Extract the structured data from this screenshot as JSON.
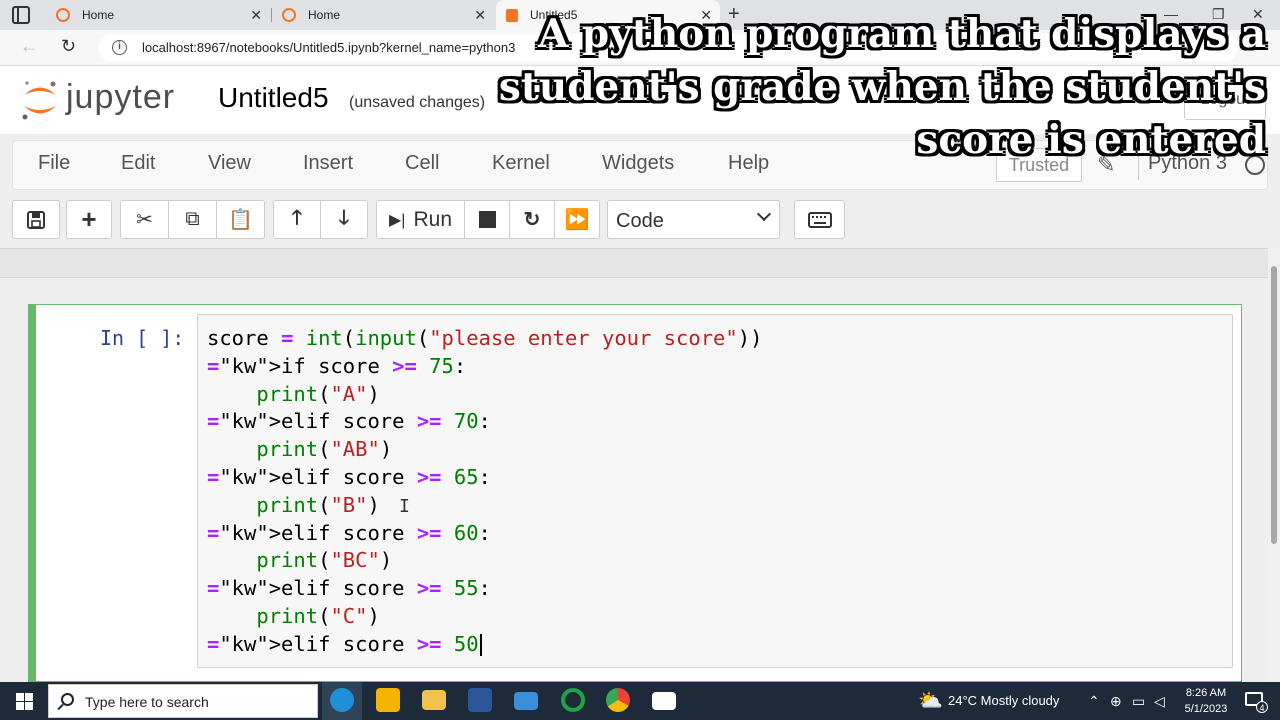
{
  "browser": {
    "tabs": [
      {
        "title": "Home"
      },
      {
        "title": "Home"
      },
      {
        "title": "Untitled5"
      }
    ],
    "url": "localhost:8967/notebooks/Untitled5.ipynb?kernel_name=python3"
  },
  "jupyter": {
    "logo_text": "jupyter",
    "notebook_title": "Untitled5",
    "save_status": "(unsaved changes)",
    "logout_label": "Logout",
    "menu": [
      "File",
      "Edit",
      "View",
      "Insert",
      "Cell",
      "Kernel",
      "Widgets",
      "Help"
    ],
    "trusted_label": "Trusted",
    "kernel_name": "Python 3",
    "run_label": "Run",
    "cell_type": "Code",
    "prompt": "In [ ]:"
  },
  "code_lines": [
    "score = int(input(\"please enter your score\"))",
    "if score >= 75:",
    "    print(\"A\")",
    "elif score >= 70:",
    "    print(\"AB\")",
    "elif score >= 65:",
    "    print(\"B\")",
    "elif score >= 60:",
    "    print(\"BC\")",
    "elif score >= 55:",
    "    print(\"C\")",
    "elif score >= 50"
  ],
  "caption": "A python program that displays a student's grade when the student's score is entered",
  "taskbar": {
    "search_placeholder": "Type here to search",
    "weather": "24°C  Mostly cloudy",
    "time": "8:26 AM",
    "date": "5/1/2023",
    "notification_count": "4"
  },
  "colors": {
    "jupyter_orange": "#f37626",
    "cell_selected": "#66bb6a",
    "prompt_blue": "#303f9f",
    "keyword_green": "#008000",
    "operator_purple": "#aa22ff",
    "string_red": "#ba2121"
  }
}
